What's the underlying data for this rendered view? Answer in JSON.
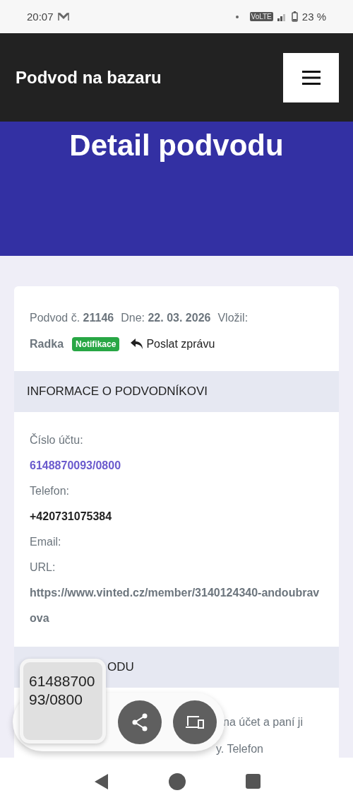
{
  "status_bar": {
    "time": "20:07",
    "network": "VoLTE",
    "battery": "23 %"
  },
  "header": {
    "title": "Podvod na bazaru"
  },
  "hero": {
    "title": "Detail podvodu"
  },
  "card": {
    "meta": {
      "number_label": "Podvod č.",
      "number": "21146",
      "date_label": "Dne:",
      "date": "22. 03. 2026",
      "author_label": "Vložil:",
      "author": "Radka",
      "badge": "Notifikace",
      "reply": "Poslat zprávu"
    },
    "sections": [
      {
        "title": "INFORMACE O PODVODNÍKOVI",
        "fields": [
          {
            "label": "Číslo účtu:",
            "value": "6148870093/0800",
            "kind": "link"
          },
          {
            "label": "Telefon:",
            "value": "+420731075384",
            "kind": "bold"
          },
          {
            "label": "Email:"
          },
          {
            "label": "URL:",
            "value": "https://www.vinted.cz/member/3140124340-andoubravova",
            "kind": "muted"
          }
        ]
      },
      {
        "title": "ODU",
        "lines": [
          "na účet a paní ji",
          "y. Telefon"
        ]
      }
    ]
  },
  "clipboard": {
    "text": "6148870093/0800"
  }
}
